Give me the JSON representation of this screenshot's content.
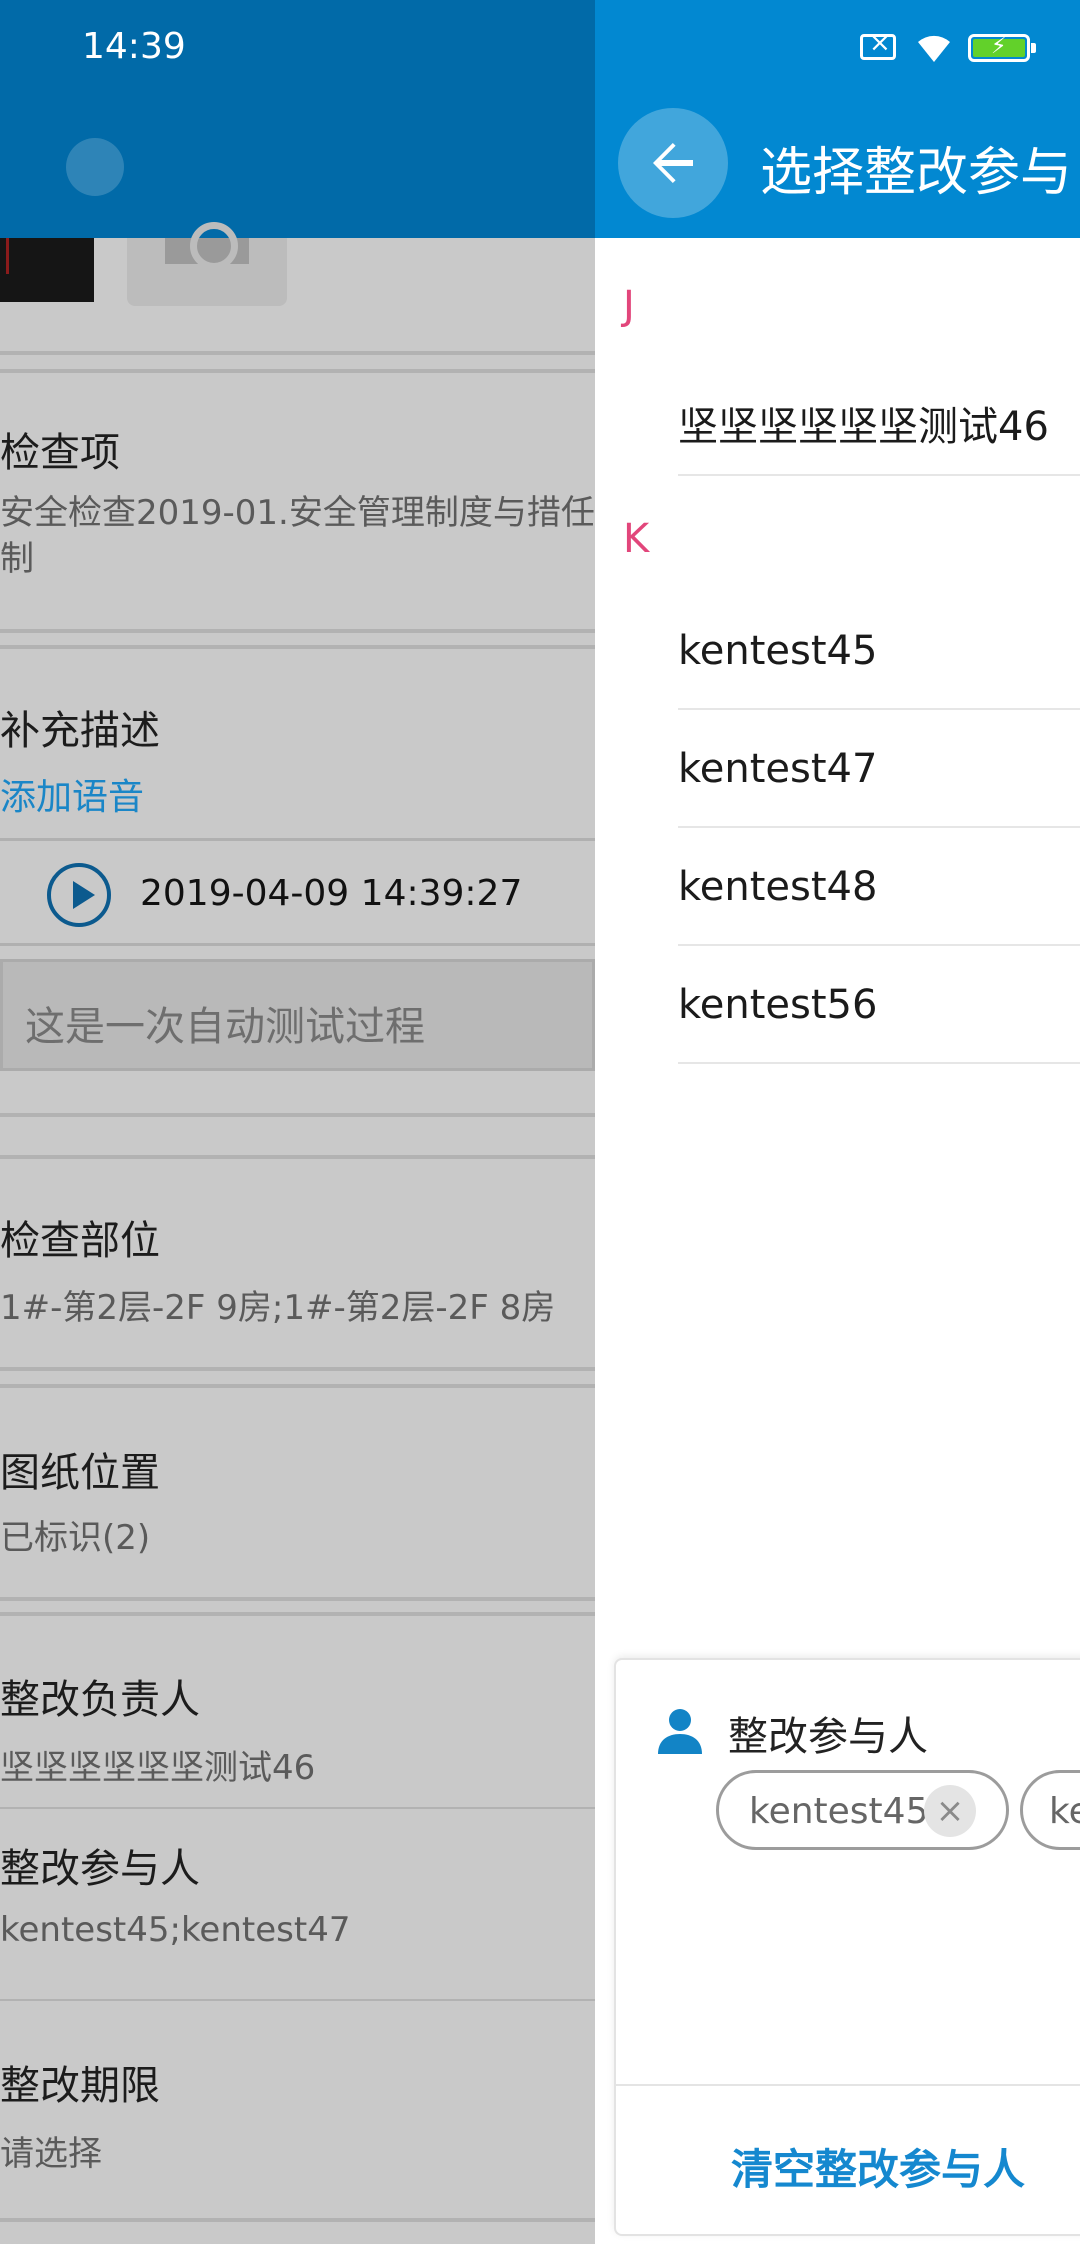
{
  "status_bar": {
    "time": "14:39"
  },
  "left_page": {
    "sections": {
      "check_item": {
        "title": "检查项",
        "value": "安全检查2019-01.安全管理制度与措任制"
      },
      "supplement": {
        "title": "补充描述",
        "add_voice": "添加语音"
      },
      "voice_record": {
        "timestamp": "2019-04-09 14:39:27"
      },
      "note": {
        "text": "这是一次自动测试过程"
      },
      "check_location": {
        "title": "检查部位",
        "value": "1#-第2层-2F 9房;1#-第2层-2F 8房"
      },
      "drawing_position": {
        "title": "图纸位置",
        "value": "已标识(2)"
      },
      "rectify_owner": {
        "title": "整改负责人",
        "value": "坚坚坚坚坚坚测试46"
      },
      "rectify_participants": {
        "title": "整改参与人",
        "value": "kentest45;kentest47"
      },
      "rectify_deadline": {
        "title": "整改期限",
        "value": "请选择"
      }
    }
  },
  "drawer": {
    "title": "选择整改参与",
    "back_icon": "arrow-left-icon",
    "groups": [
      {
        "letter": "J",
        "people": [
          "坚坚坚坚坚坚测试46"
        ]
      },
      {
        "letter": "K",
        "people": [
          "kentest45",
          "kentest47",
          "kentest48",
          "kentest56"
        ]
      }
    ],
    "selection_panel": {
      "title": "整改参与人",
      "icon": "person-icon",
      "chips": [
        "kentest45",
        "ke"
      ],
      "clear_label": "清空整改参与人"
    }
  },
  "colors": {
    "drawer_appbar": "#0288d1",
    "left_appbar": "#016aa8",
    "section_letter": "#e2467b",
    "link": "#1588cf"
  }
}
